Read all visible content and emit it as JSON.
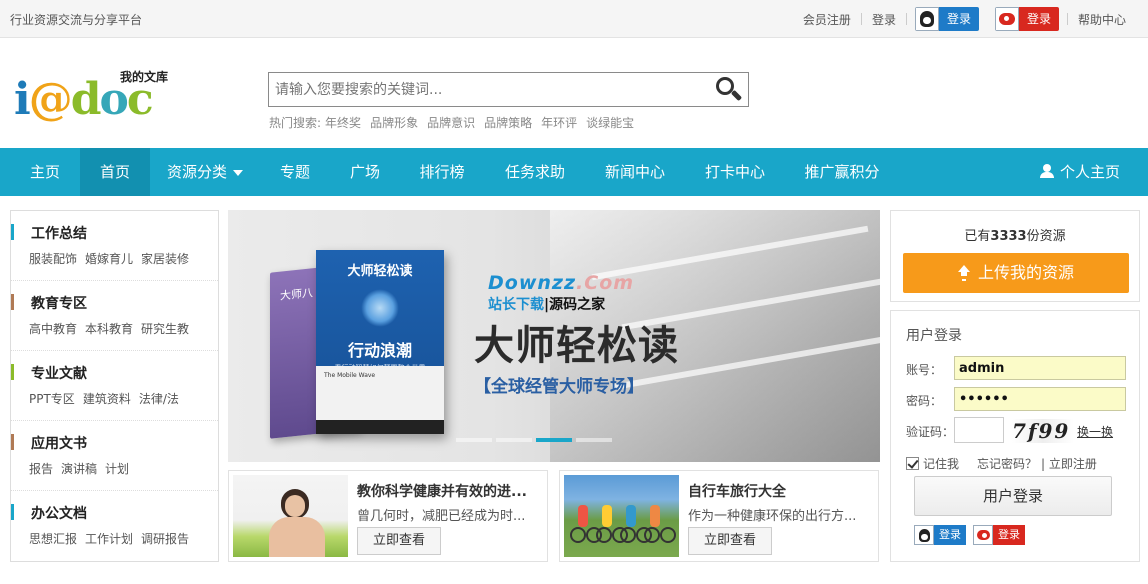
{
  "topbar": {
    "slogan": "行业资源交流与分享平台",
    "register": "会员注册",
    "login": "登录",
    "qq_login": "登录",
    "weibo_login": "登录",
    "help": "帮助中心"
  },
  "logo": {
    "tagline": "我的文库",
    "letters": [
      "i",
      "@",
      "d",
      "o",
      "c"
    ]
  },
  "search": {
    "placeholder": "请输入您要搜索的关键词...",
    "hot_label": "热门搜索:",
    "hot_terms": [
      "年终奖",
      "品牌形象",
      "品牌意识",
      "品牌策略",
      "年环评",
      "谈绿能宝"
    ]
  },
  "nav": {
    "items": [
      "主页",
      "首页",
      "资源分类",
      "专题",
      "广场",
      "排行榜",
      "任务求助",
      "新闻中心",
      "打卡中心",
      "推广赢积分"
    ],
    "active_index": 1,
    "profile": "个人主页"
  },
  "categories": [
    {
      "title": "工作总结",
      "color": "#19a6c9",
      "links": [
        "服装配饰",
        "婚嫁育儿",
        "家居装修"
      ]
    },
    {
      "title": "教育专区",
      "color": "#b07a55",
      "links": [
        "高中教育",
        "本科教育",
        "研究生教"
      ]
    },
    {
      "title": "专业文献",
      "color": "#8bbb2a",
      "links": [
        "PPT专区",
        "建筑资料",
        "法律/法"
      ]
    },
    {
      "title": "应用文书",
      "color": "#b07a55",
      "links": [
        "报告",
        "演讲稿",
        "计划"
      ]
    },
    {
      "title": "办公文档",
      "color": "#19a6c9",
      "links": [
        "思想汇报",
        "工作计划",
        "调研报告"
      ]
    }
  ],
  "banner": {
    "book_back_title": "大师八",
    "book_title": "大师轻松读",
    "book_subtitle": "",
    "book_main_title": "行动浪潮",
    "book_main_subtitle": "看行动智慧如何颠覆整个世界",
    "book_en": "The Mobile Wave",
    "watermark_en": "Downzz",
    "watermark_com": ".Com",
    "watermark_cn_a": "站长下载",
    "watermark_cn_b": "|源码之家",
    "headline": "大师轻松读",
    "subline": "【全球经管大师专场】",
    "slide_count": 3,
    "active_slide": 1
  },
  "cards": [
    {
      "title": "教你科学健康并有效的进...",
      "desc": "曾几何时，减肥已经成为时...",
      "button": "立即查看",
      "image": "woman-fitness-photo"
    },
    {
      "title": "自行车旅行大全",
      "desc": "作为一种健康环保的出行方...",
      "button": "立即查看",
      "image": "cyclists-photo"
    }
  ],
  "upload": {
    "count_prefix": "已有",
    "count": "3333",
    "count_suffix": "份资源",
    "button": "上传我的资源"
  },
  "login": {
    "title": "用户登录",
    "account_label": "账号：",
    "account_value": "admin",
    "password_label": "密码：",
    "password_value": "admin1",
    "captcha_label": "验证码：",
    "captcha_text": "7f99",
    "refresh": "换一换",
    "remember": "记住我",
    "forgot": "忘记密码？",
    "register": "| 立即注册",
    "submit": "用户登录",
    "qq_login": "登录",
    "weibo_login": "登录"
  }
}
